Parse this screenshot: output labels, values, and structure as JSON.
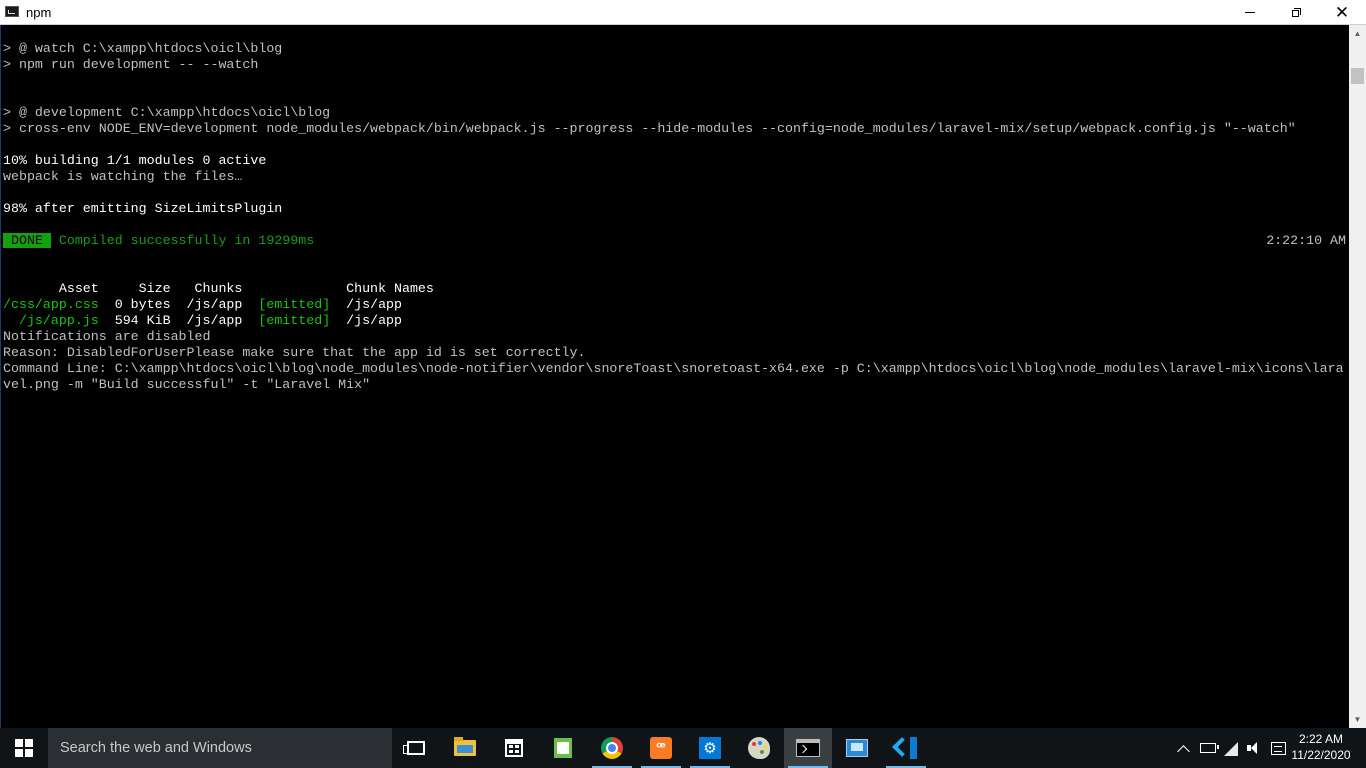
{
  "window": {
    "title": "npm",
    "minimize_label": "Minimize",
    "maximize_label": "Restore",
    "close_label": "Close"
  },
  "console": {
    "lines": [
      "> @ watch C:\\xampp\\htdocs\\oicl\\blog",
      "> npm run development -- --watch",
      "",
      "",
      "> @ development C:\\xampp\\htdocs\\oicl\\blog",
      "> cross-env NODE_ENV=development node_modules/webpack/bin/webpack.js --progress --hide-modules --config=node_modules/laravel-mix/setup/webpack.config.js \"--watch\"",
      "",
      "10% building 1/1 modules 0 active",
      "webpack is watching the files…",
      "",
      "98% after emitting SizeLimitsPlugin"
    ],
    "done_badge": " DONE ",
    "compiled_message": " Compiled successfully in 19299ms",
    "timestamp": "2:22:10 AM",
    "table_header": "       Asset     Size   Chunks             Chunk Names",
    "table_rows": [
      {
        "asset": "/css/app.css",
        "size": "  0 bytes  /js/app  ",
        "status": "[emitted]",
        "names": "  /js/app"
      },
      {
        "asset": "  /js/app.js",
        "size": "  594 KiB  /js/app  ",
        "status": "[emitted]",
        "names": "  /js/app"
      }
    ],
    "notification_lines": [
      "Notifications are disabled",
      "Reason: DisabledForUserPlease make sure that the app id is set correctly.",
      "Command Line: C:\\xampp\\htdocs\\oicl\\blog\\node_modules\\node-notifier\\vendor\\snoreToast\\snoretoast-x64.exe -p C:\\xampp\\htdocs\\oicl\\blog\\node_modules\\laravel-mix\\icons\\lara",
      "vel.png -m \"Build successful\" -t \"Laravel Mix\""
    ]
  },
  "taskbar": {
    "search_placeholder": "Search the web and Windows",
    "apps": [
      "task-view-icon",
      "file-explorer-icon",
      "store-icon",
      "notepad-plus-icon",
      "chrome-icon",
      "xampp-icon",
      "settings-icon",
      "paint-icon",
      "cmd-icon",
      "remote-desktop-icon",
      "vscode-icon"
    ],
    "clock_time": "2:22 AM",
    "clock_date": "11/22/2020",
    "xampp_glyph": "ꟹ",
    "settings_glyph": "⚙"
  },
  "colors": {
    "console_bg": "#000000",
    "console_text": "#c0c0c0",
    "success_green": "#13a10e",
    "taskbar_bg": "#101417"
  }
}
